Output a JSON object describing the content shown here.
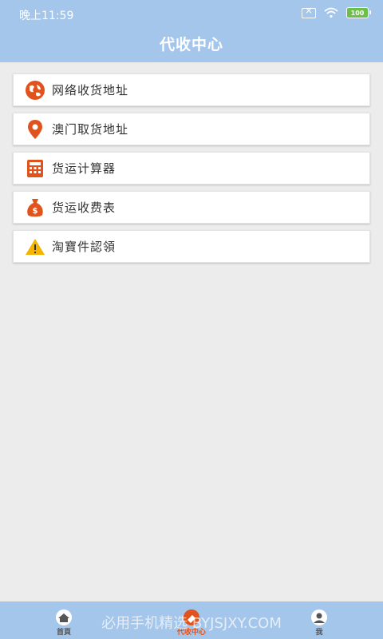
{
  "status_bar": {
    "time": "晚上11:59",
    "battery": "100"
  },
  "header": {
    "title": "代收中心"
  },
  "menu": {
    "items": [
      {
        "label": "网络收货地址",
        "icon": "globe-icon"
      },
      {
        "label": "澳门取货地址",
        "icon": "location-pin-icon"
      },
      {
        "label": "货运计算器",
        "icon": "calculator-icon"
      },
      {
        "label": "货运收费表",
        "icon": "money-bag-icon"
      },
      {
        "label": "淘寶件認領",
        "icon": "warning-icon"
      }
    ]
  },
  "tabbar": {
    "tabs": [
      {
        "label": "首頁",
        "icon": "home-icon"
      },
      {
        "label": "代收中心",
        "icon": "collection-icon",
        "active": true
      },
      {
        "label": "我",
        "icon": "user-icon"
      }
    ]
  },
  "watermark": "必用手机精选 BYJSJXY.COM",
  "colors": {
    "header_bg": "#a4c6ea",
    "accent": "#e0531c",
    "page_bg": "#ececec"
  }
}
